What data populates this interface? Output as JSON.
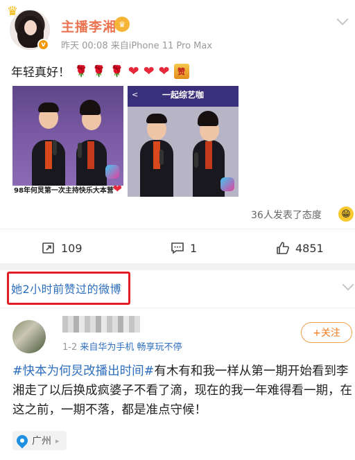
{
  "post": {
    "author": "主播李湘",
    "meta": "昨天 00:08  来自iPhone 11 Pro Max",
    "content_text": "年轻真好！",
    "emoji_suffix": "🌹🌹🌹❤❤❤",
    "zan_badge": "赞",
    "images": [
      {
        "caption": "98年何炅第一次主持快乐大本营"
      },
      {
        "banner": "一起综艺咖",
        "back": "<"
      }
    ],
    "reactions": "36人发表了态度",
    "actions": {
      "repost": "109",
      "comment": "1",
      "like": "4851"
    }
  },
  "liked_section": {
    "label": "她2小时前赞过的微博"
  },
  "second_post": {
    "meta_date": "1-2",
    "meta_source": "来自华为手机 畅享玩不停",
    "follow": "+关注",
    "tags": [
      "#快本为何炅改播出时间#"
    ],
    "body": "有木有和我一样从第一期开始看到李湘走了以后换成疯婆子不看了滴，现在的我一年难得看一期，在这之前，一期不落，都是准点守候！",
    "location": "广州"
  }
}
